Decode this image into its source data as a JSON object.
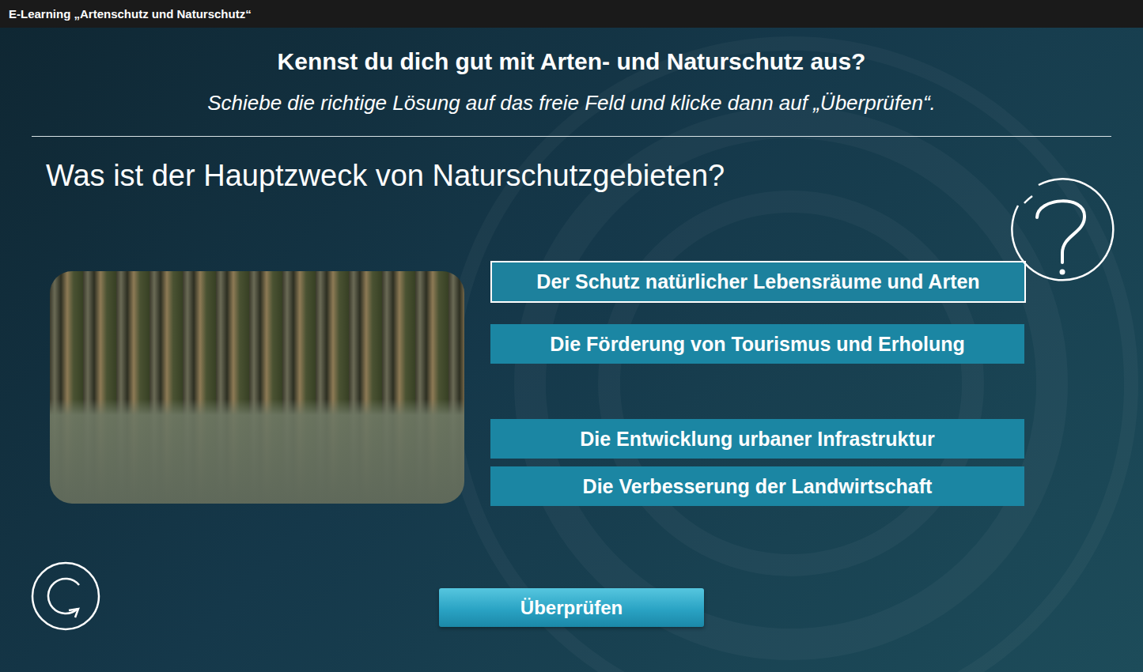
{
  "window": {
    "title": "E-Learning „Artenschutz und Naturschutz“"
  },
  "header": {
    "title": "Kennst du dich gut mit Arten- und Naturschutz aus?",
    "instruction": "Schiebe die richtige Lösung auf das freie Feld und klicke dann auf „Überprüfen“."
  },
  "question": "Was ist der Hauptzweck von Naturschutzgebieten?",
  "drop_zone": {
    "label": "Der Schutz natürlicher Lebensräume und Arten",
    "filled": true
  },
  "options": [
    {
      "kind": "answer",
      "label": "Die Förderung von Tourismus und Erholung"
    },
    {
      "kind": "empty"
    },
    {
      "kind": "answer",
      "label": "Die Entwicklung urbaner Infrastruktur"
    },
    {
      "kind": "answer",
      "label": "Die Verbesserung der Landwirtschaft"
    }
  ],
  "buttons": [
    "Überprüfen"
  ]
}
